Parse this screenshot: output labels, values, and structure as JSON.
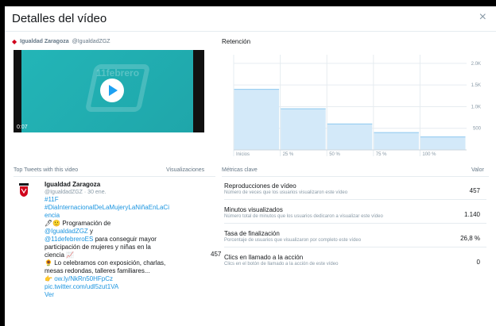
{
  "header": {
    "title": "Detalles del vídeo",
    "close_label": "×"
  },
  "author": {
    "name": "Igualdad Zaragoza",
    "handle": "@IgualdadZGZ"
  },
  "video": {
    "time": "0:07",
    "poster_text": "11febrero"
  },
  "retention": {
    "title": "Retención",
    "chart_data": {
      "type": "bar",
      "categories": [
        "Inicios",
        "25 %",
        "50 %",
        "75 %",
        "100 %"
      ],
      "values": [
        1400,
        950,
        600,
        400,
        300
      ],
      "ylim": [
        0,
        2200
      ],
      "yticks": [
        "2.0K",
        "1.5K",
        "1.0K",
        "500"
      ],
      "ytick_values": [
        2000,
        1500,
        1000,
        500
      ],
      "colors": {
        "bar": "#d3e9f9",
        "bar_stroke": "#8bc8ef"
      }
    }
  },
  "top_tweets": {
    "header": "Top Tweets with this video",
    "views_header": "Visualizaciones",
    "tweet": {
      "name": "Igualdad Zaragoza",
      "meta": "@IgualdadZGZ · 30 ene.",
      "hashtag1": "#11F",
      "hashtag2": "#DiaInternacionalDeLaMujeryLaNiñaEnLaCiencia",
      "line_prog_icon": "🖊🙂",
      "line_prog": " Programación de",
      "mention1": "@IgualdadZGZ",
      "y": " y",
      "mention2": "@11defebreroES",
      "text1": " para conseguir mayor participación de mujeres y niñas en la ciencia 📈",
      "text2_icon": "🌻",
      "text2": " Lo celebramos con exposición, charlas, mesas redondas, talleres familiares...",
      "link_icon": "👉",
      "link1": "ow.ly/NkRn50HFpCz",
      "link2": "pic.twitter.com/udl5zut1VA",
      "more": "Ver",
      "views": "457"
    }
  },
  "metrics": {
    "header": "Métricas clave",
    "value_header": "Valor",
    "items": [
      {
        "label": "Reproducciones de vídeo",
        "desc": "Número de veces que los usuarios visualizaron este vídeo",
        "value": "457"
      },
      {
        "label": "Minutos visualizados",
        "desc": "Número total de minutos que los usuarios dedicaron a visualizar este vídeo",
        "value": "1.140"
      },
      {
        "label": "Tasa de finalización",
        "desc": "Porcentaje de usuarios que visualizaron por completo este vídeo",
        "value": "26,8 %"
      },
      {
        "label": "Clics en llamado a la acción",
        "desc": "Clics en el botón de llamado a la acción de este vídeo",
        "value": "0"
      }
    ]
  }
}
